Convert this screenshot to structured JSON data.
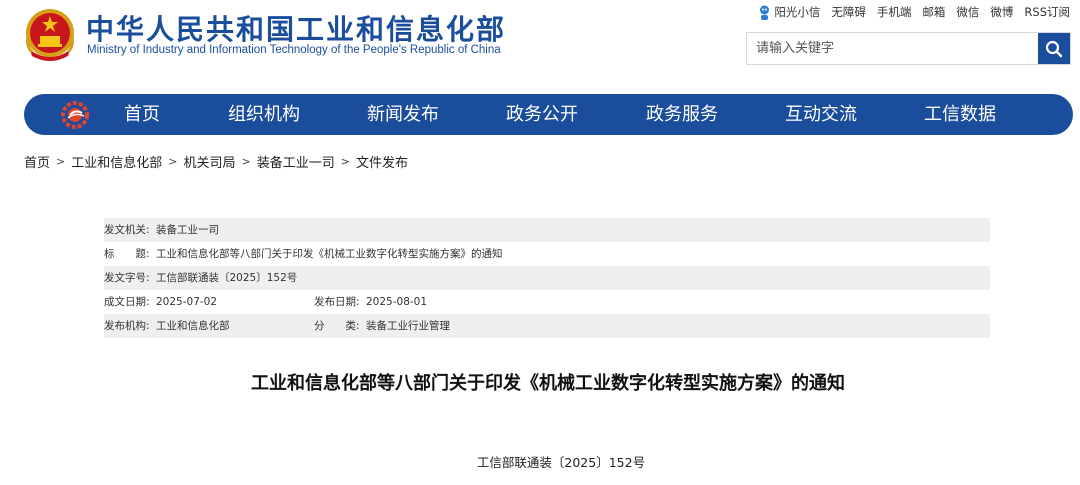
{
  "header": {
    "title": "中华人民共和国工业和信息化部",
    "subtitle": "Ministry of Industry and Information Technology of the People's Republic of China",
    "links": [
      "阳光小信",
      "无障碍",
      "手机端",
      "邮箱",
      "微信",
      "微博",
      "RSS订阅"
    ],
    "search_placeholder": "请输入关键字"
  },
  "nav": {
    "items": [
      "首页",
      "组织机构",
      "新闻发布",
      "政务公开",
      "政务服务",
      "互动交流",
      "工信数据"
    ]
  },
  "breadcrumb": [
    "首页",
    "工业和信息化部",
    "机关司局",
    "装备工业一司",
    "文件发布"
  ],
  "info": {
    "issuing_org_label": "发文机关:",
    "issuing_org": "装备工业一司",
    "title_label": "标　　题:",
    "title": "工业和信息化部等八部门关于印发《机械工业数字化转型实施方案》的通知",
    "doc_no_label": "发文字号:",
    "doc_no": "工信部联通装〔2025〕152号",
    "written_date_label": "成文日期:",
    "written_date": "2025-07-02",
    "publish_date_label": "发布日期:",
    "publish_date": "2025-08-01",
    "publisher_label": "发布机构:",
    "publisher": "工业和信息化部",
    "category_label": "分　　类:",
    "category": "装备工业行业管理"
  },
  "document": {
    "title": "工业和信息化部等八部门关于印发《机械工业数字化转型实施方案》的通知",
    "number": "工信部联通装〔2025〕152号"
  },
  "colors": {
    "brand_blue": "#1a4d9c",
    "row_shade": "#efefef"
  },
  "icons": [
    "national-emblem-icon",
    "robot-icon",
    "search-icon",
    "site-logo-icon"
  ]
}
